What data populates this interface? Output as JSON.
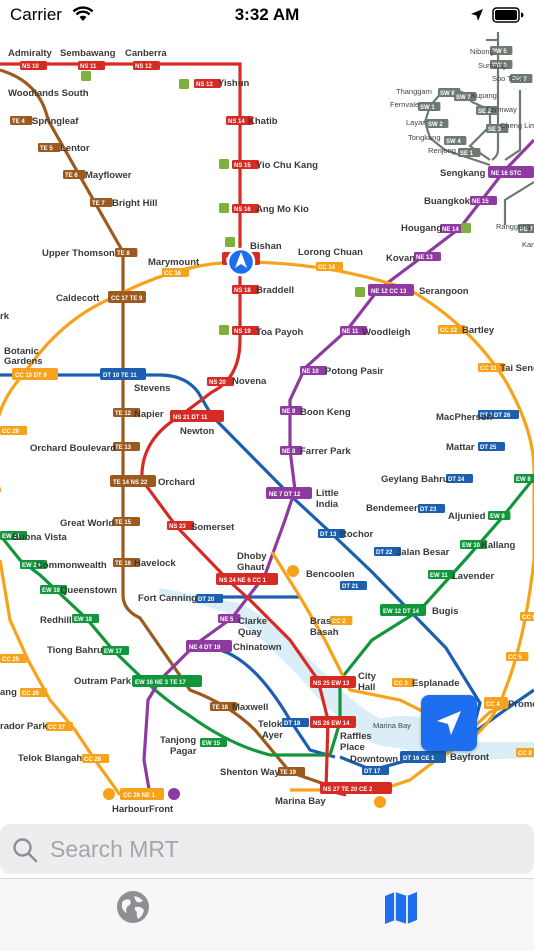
{
  "status": {
    "carrier": "Carrier",
    "time": "3:32 AM"
  },
  "search": {
    "placeholder": "Search MRT"
  },
  "tabs": [
    {
      "icon": "globe-icon"
    },
    {
      "icon": "map-icon"
    }
  ],
  "colors": {
    "ns": "#d62a25",
    "ew": "#12963c",
    "ne": "#8e3aa0",
    "cc": "#f6a31b",
    "dt": "#1b5fae",
    "te": "#9c5a1e",
    "lrt": "#6e7a71",
    "accent": "#1e6ff0"
  },
  "stations": {
    "admiralty": "Admiralty",
    "sembawang": "Sembawang",
    "canberra": "Canberra",
    "yishun": "Yishun",
    "woodlands_south": "Woodlands South",
    "springleaf": "Springleaf",
    "khatib": "Khatib",
    "lentor": "Lentor",
    "mayflower": "Mayflower",
    "yio_chu_kang": "Yio Chu Kang",
    "bright_hill": "Bright Hill",
    "ang_mo_kio": "Ang Mo Kio",
    "bishan": "Bishan",
    "upper_thomson": "Upper Thomson",
    "marymount": "Marymount",
    "lorong_chuan": "Lorong Chuan",
    "kovan": "Kovan",
    "hougang": "Hougang",
    "buangkok": "Buangkok",
    "sengkang": "Sengkang",
    "caldecott": "Caldecott",
    "braddell": "Braddell",
    "serangoon": "Serangoon",
    "woodleigh": "Woodleigh",
    "bartley": "Bartley",
    "toa_payoh": "Toa Payoh",
    "botanic_gardens_1": "Botanic",
    "botanic_gardens_2": "Gardens",
    "potong_pasir": "Potong Pasir",
    "tai_seng": "Tai Seng",
    "stevens": "Stevens",
    "novena": "Novena",
    "boon_keng": "Boon Keng",
    "macpherson": "MacPherson",
    "napier": "Napier",
    "newton": "Newton",
    "mattar": "Mattar",
    "orchard_boulevard": "Orchard Boulevard",
    "farrer_park": "Farrer Park",
    "orchard": "Orchard",
    "geylang_bahru": "Geylang Bahru",
    "little_india_1": "Little",
    "little_india_2": "India",
    "great_world": "Great World",
    "bendemeer": "Bendemeer",
    "aljunied": "Aljunied",
    "somerset": "Somerset",
    "buona_vista": "Buona Vista",
    "rochor": "Rochor",
    "kallang": "Kallang",
    "commonwealth": "Commonwealth",
    "havelock": "Havelock",
    "dhoby_ghaut_1": "Dhoby",
    "dhoby_ghaut_2": "Ghaut",
    "jalan_besar": "Jalan Besar",
    "queenstown": "Queenstown",
    "bencoolen": "Bencoolen",
    "lavender": "Lavender",
    "fort_canning": "Fort Canning",
    "redhill": "Redhill",
    "bugis": "Bugis",
    "clarke_quay_1": "Clarke",
    "clarke_quay_2": "Quay",
    "bras_basah_1": "Bras",
    "bras_basah_2": "Basah",
    "tiong_bahru": "Tiong Bahru",
    "chinatown": "Chinatown",
    "outram_park": "Outram Park",
    "esplanade": "Esplanade",
    "city_hall_1": "City",
    "city_hall_2": "Hall",
    "promenade": "Prome",
    "maxwell": "Maxwell",
    "telok_ayer_1": "Telok",
    "telok_ayer_2": "Ayer",
    "raffles_place_1": "Raffles",
    "raffles_place_2": "Place",
    "tanjong_pagar_1": "Tanjong",
    "tanjong_pagar_2": "Pagar",
    "downtown": "Downtown",
    "bayfront": "Bayfront",
    "telok_blangah": "Telok Blangah",
    "shenton_way": "Shenton Way",
    "harbourfront": "HarbourFront",
    "marina_bay": "Marina Bay",
    "nibong": "Nibong",
    "sumang": "Sumang",
    "soo_teck": "Soo Teck",
    "thanggam": "Thanggam",
    "kupang": "Kupang",
    "fernvale": "Fernvale",
    "farmway": "Farmway",
    "layar": "Layar",
    "cheng_lim": "Cheng Lim",
    "tongkang": "Tongkang",
    "renjong": "Renjong",
    "ranggung": "Ranggung",
    "marina_bay_water": "Marina Bay",
    "frag_k": "rk",
    "frag_ang": "ang",
    "frag_rador": "rador Park",
    "frag_kang": "Kang"
  }
}
